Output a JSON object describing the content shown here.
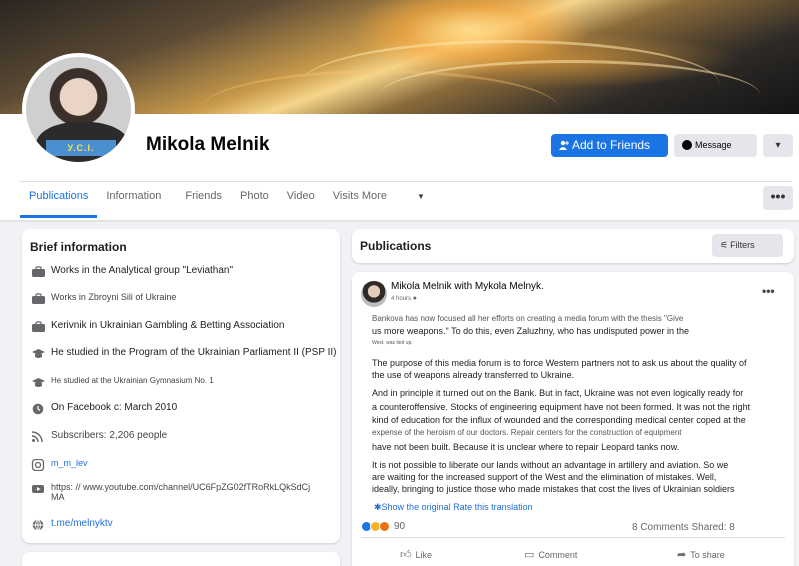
{
  "profile": {
    "name": "Mikola Melnik",
    "avatar_badge": "У.С.І.",
    "add_friends_label": "Add to Friends",
    "message_label": "Message",
    "more_label": "▾"
  },
  "tabs": [
    {
      "label": "Publications"
    },
    {
      "label": "Information"
    },
    {
      "label": "Friends"
    },
    {
      "label": "Photo"
    },
    {
      "label": "Video"
    },
    {
      "label": "Visits More"
    }
  ],
  "tabs_more": "•••",
  "brief": {
    "title": "Brief information",
    "items": [
      {
        "icon": "briefcase-icon",
        "text": "Works in the Analytical group \"Leviathan\""
      },
      {
        "icon": "briefcase-icon",
        "text": "Works in Zbroyni Sili of Ukraine"
      },
      {
        "icon": "briefcase-icon",
        "text": "Kerivnik in Ukrainian Gambling & Betting Association"
      },
      {
        "icon": "graduation-cap-icon",
        "text": "He studied in the Program of the Ukrainian Parliament II (PSP II)"
      },
      {
        "icon": "graduation-cap-icon",
        "text": "He studied at the Ukrainian Gymnasium No. 1"
      },
      {
        "icon": "clock-icon",
        "text": "On Facebook c: March 2010"
      },
      {
        "icon": "rss-icon",
        "text": "Subscribers: 2,206 people"
      },
      {
        "icon": "instagram-icon",
        "text": "m_m_lev"
      },
      {
        "icon": "youtube-icon",
        "text": "https: // www.youtube.com/channel/UC6FpZG02fTRoRkLQkSdCj",
        "text2": "MA"
      },
      {
        "icon": "globe-icon",
        "text": "t.me/melnyktv"
      }
    ]
  },
  "publications": {
    "title": "Publications",
    "filters_label": "Filters"
  },
  "post": {
    "author": "Mikola Melnik with Mykola Melnyk.",
    "time": "4 hours",
    "lines": [
      "Bankova has now focused all her efforts on creating a media forum with the thesis \"Give",
      "us more weapons.\" To do this, even Zaluzhny, who has undisputed power in the",
      "West, was tied up.",
      "The purpose of this media forum is to force Western partners not to ask us about the quality of",
      "the use of weapons already transferred to Ukraine.",
      "And in principle it turned out on the Bank. But in fact, Ukraine was not even logically ready for",
      "a counteroffensive. Stocks of engineering equipment have not been formed. It was not the right",
      "kind of education for the influx of wounded and the corresponding medical center coped at the",
      "expense of the heroism of our doctors. Repair centers for the construction of equipment",
      "have not been built. Because it is unclear where to repair Leopard tanks now.",
      "It is not possible to liberate our lands without an advantage in artillery and aviation. So we",
      "are waiting for the increased support of the West and the elimination of mistakes. Well,",
      "ideally, bringing to justice those who made mistakes that cost the lives of Ukrainian soldiers"
    ],
    "show_original": "Show the original Rate this translation",
    "reaction_count": "90",
    "comments_shares": "8 Comments Shared: 8",
    "actions": {
      "like": "Like",
      "comment": "Comment",
      "share": "To share"
    }
  },
  "colors": {
    "accent": "#1b74e4",
    "background": "#f0f2f5",
    "link": "#216fdb"
  }
}
